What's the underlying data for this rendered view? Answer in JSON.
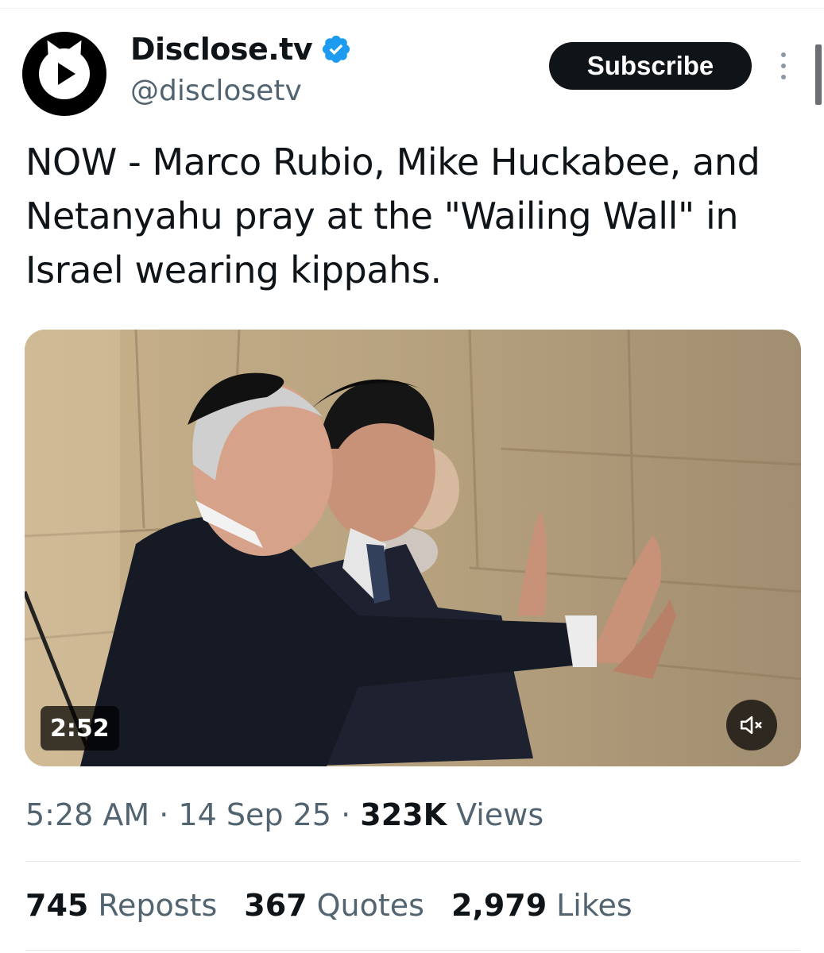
{
  "author": {
    "display_name": "Disclose.tv",
    "handle": "@disclosetv",
    "verified": true,
    "avatar_icon": "play-in-speech-bubble-logo"
  },
  "actions": {
    "subscribe_label": "Subscribe",
    "more_icon": "vertical-ellipsis-icon"
  },
  "tweet": {
    "text": "NOW - Marco Rubio, Mike Huckabee, and Netanyahu pray at the \"Wailing Wall\" in Israel wearing kippahs."
  },
  "media": {
    "type": "video",
    "duration": "2:52",
    "mute_icon": "volume-muted-icon"
  },
  "meta": {
    "time": "5:28 AM",
    "separator": "·",
    "date": "14 Sep 25",
    "views_count": "323K",
    "views_label": "Views"
  },
  "stats": {
    "reposts_count": "745",
    "reposts_label": "Reposts",
    "quotes_count": "367",
    "quotes_label": "Quotes",
    "likes_count": "2,979",
    "likes_label": "Likes"
  },
  "colors": {
    "text": "#0f1419",
    "secondary": "#536471",
    "verified": "#1d9bf0",
    "button_bg": "#0f1419"
  }
}
